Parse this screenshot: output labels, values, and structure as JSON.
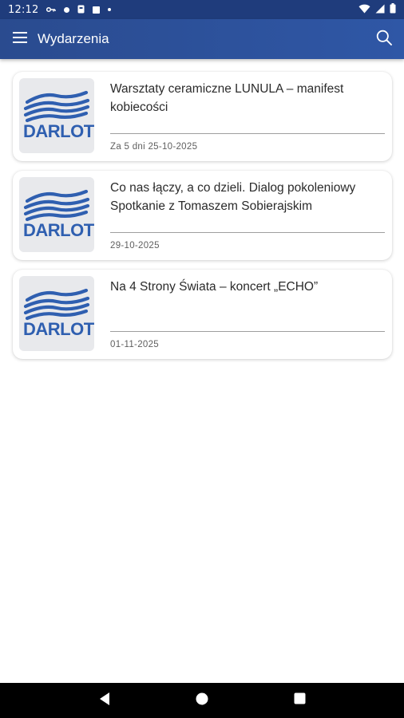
{
  "status_bar": {
    "time": "12:12",
    "icons_left": [
      "key-icon",
      "circle-icon",
      "box-icon",
      "square-icon",
      "dot-icon"
    ],
    "icons_right": [
      "wifi-icon",
      "signal-icon",
      "battery-icon"
    ]
  },
  "app_bar": {
    "title": "Wydarzenia",
    "menu_icon": "hamburger-menu-icon",
    "search_icon": "search-icon",
    "color": "#2f57a6"
  },
  "events": [
    {
      "title": "Warsztaty ceramiczne LUNULA – manifest kobiecości",
      "date": "Za 5 dni 25-10-2025",
      "logo_text": "DARLOT"
    },
    {
      "title": "Co nas łączy, a co dzieli. Dialog pokoleniowy Spotkanie z Tomaszem Sobierajskim",
      "date": "29-10-2025",
      "logo_text": "DARLOT"
    },
    {
      "title": "Na 4 Strony Świata – koncert „ECHO”",
      "date": "01-11-2025",
      "logo_text": "DARLOT"
    }
  ],
  "nav_bar": {
    "buttons": [
      "back-icon",
      "home-icon",
      "recents-icon"
    ]
  },
  "colors": {
    "primary": "#2f57a6",
    "status_bar": "#1f3c7c",
    "logo_blue": "#2f5fb0"
  }
}
